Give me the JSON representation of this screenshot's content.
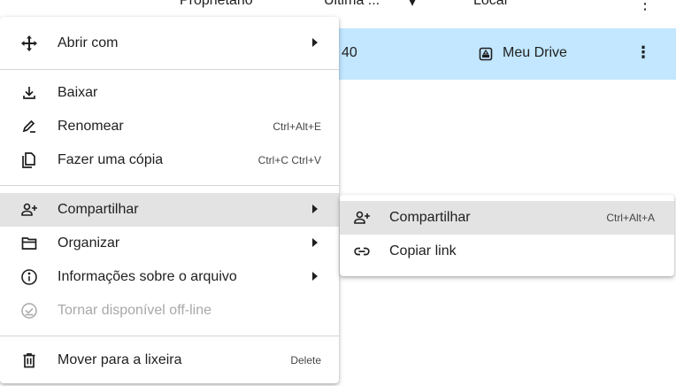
{
  "header": {
    "col_owner": "Proprietário",
    "col_modified": "Última ...",
    "col_sort_arrow": "▾",
    "col_location": "Local",
    "kebab": "⋮"
  },
  "selected_row": {
    "partial_time": "40",
    "location": "Meu Drive",
    "kebab": "⋮"
  },
  "menu": {
    "open_with": {
      "label": "Abrir com",
      "icon": "move-arrows-icon"
    },
    "download": {
      "label": "Baixar",
      "icon": "download-icon"
    },
    "rename": {
      "label": "Renomear",
      "shortcut": "Ctrl+Alt+E",
      "icon": "edit-icon"
    },
    "copy": {
      "label": "Fazer uma cópia",
      "shortcut": "Ctrl+C Ctrl+V",
      "icon": "copy-icon"
    },
    "share": {
      "label": "Compartilhar",
      "icon": "person-add-icon"
    },
    "organize": {
      "label": "Organizar",
      "icon": "folder-icon"
    },
    "info": {
      "label": "Informações sobre o arquivo",
      "icon": "info-icon"
    },
    "offline": {
      "label": "Tornar disponível off-line",
      "icon": "offline-icon"
    },
    "trash": {
      "label": "Mover para a lixeira",
      "shortcut": "Delete",
      "icon": "trash-icon"
    }
  },
  "submenu": {
    "share": {
      "label": "Compartilhar",
      "shortcut": "Ctrl+Alt+A",
      "icon": "person-add-icon"
    },
    "copy_link": {
      "label": "Copiar link",
      "icon": "link-icon"
    }
  },
  "colors": {
    "selected_row": "#c2e7ff",
    "highlight": "#e3e3e3",
    "text": "#1f1f1f",
    "disabled": "#a8a8a8"
  }
}
